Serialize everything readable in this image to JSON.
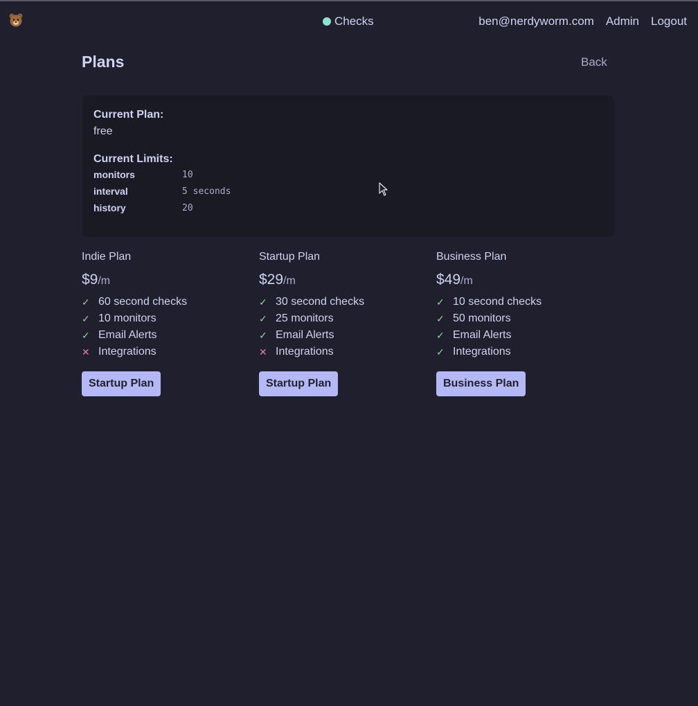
{
  "nav": {
    "logo_icon": "bear-icon",
    "center_label": "Checks",
    "status_color": "#8be3cf",
    "links": [
      "ben@nerdyworm.com",
      "Admin",
      "Logout"
    ]
  },
  "page": {
    "title": "Plans",
    "back_label": "Back"
  },
  "current": {
    "plan_label": "Current Plan:",
    "plan_value": "free",
    "limits_label": "Current Limits:",
    "limits": [
      {
        "key": "monitors",
        "value": "10"
      },
      {
        "key": "interval",
        "value": "5 seconds"
      },
      {
        "key": "history",
        "value": "20"
      }
    ]
  },
  "plans": [
    {
      "name": "Indie Plan",
      "price": "$9",
      "unit": "/m",
      "features": [
        {
          "text": "60 second checks",
          "icon": "✓"
        },
        {
          "text": "10 monitors",
          "icon": "✓"
        },
        {
          "text": "Email Alerts",
          "icon": "✓"
        },
        {
          "text": "Integrations",
          "icon": "✕"
        }
      ],
      "button": "Startup Plan"
    },
    {
      "name": "Startup Plan",
      "price": "$29",
      "unit": "/m",
      "features": [
        {
          "text": "30 second checks",
          "icon": "✓"
        },
        {
          "text": "25 monitors",
          "icon": "✓"
        },
        {
          "text": "Email Alerts",
          "icon": "✓"
        },
        {
          "text": "Integrations",
          "icon": "✕"
        }
      ],
      "button": "Startup Plan"
    },
    {
      "name": "Business Plan",
      "price": "$49",
      "unit": "/m",
      "features": [
        {
          "text": "10 second checks",
          "icon": "✓"
        },
        {
          "text": "50 monitors",
          "icon": "✓"
        },
        {
          "text": "Email Alerts",
          "icon": "✓"
        },
        {
          "text": "Integrations",
          "icon": "✓"
        }
      ],
      "button": "Business Plan"
    }
  ],
  "colors": {
    "background": "#1f1f2e",
    "card": "#1a1a25",
    "accent_button": "#b4b8f5",
    "check": "#8fd0a0",
    "cross": "#e87aa0"
  }
}
